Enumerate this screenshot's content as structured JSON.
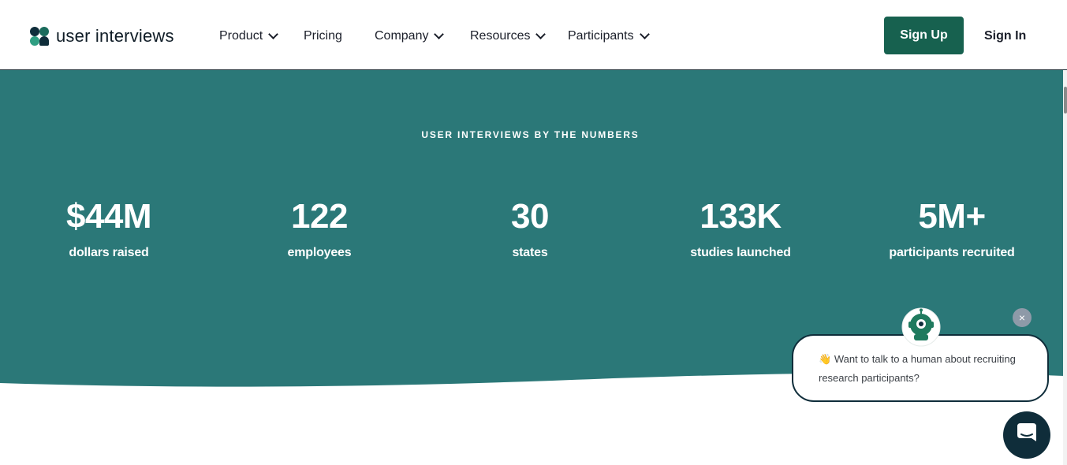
{
  "nav": {
    "logo_text": "user interviews",
    "items": [
      {
        "label": "Product",
        "has_dropdown": true
      },
      {
        "label": "Pricing",
        "has_dropdown": false
      },
      {
        "label": "Company",
        "has_dropdown": true
      },
      {
        "label": "Resources",
        "has_dropdown": true
      },
      {
        "label": "Participants",
        "has_dropdown": true
      }
    ],
    "signup_label": "Sign Up",
    "signin_label": "Sign In"
  },
  "stats": {
    "eyebrow": "USER INTERVIEWS BY THE NUMBERS",
    "items": [
      {
        "value": "$44M",
        "label": "dollars raised"
      },
      {
        "value": "122",
        "label": "employees"
      },
      {
        "value": "30",
        "label": "states"
      },
      {
        "value": "133K",
        "label": "studies launched"
      },
      {
        "value": "5M+",
        "label": "participants recruited"
      }
    ]
  },
  "chat": {
    "wave_emoji": "👋",
    "message": "Want to talk to a human about recruiting research participants?",
    "close_symbol": "×"
  },
  "icons": {
    "logo": "user-interviews-logo-icon",
    "caret": "chevron-down-icon",
    "close": "close-icon",
    "bot": "robot-avatar-icon",
    "launcher": "chat-bubble-icon"
  },
  "colors": {
    "teal_band": "#2b7878",
    "signup_bg": "#17614f",
    "navy": "#0f2d3a"
  }
}
